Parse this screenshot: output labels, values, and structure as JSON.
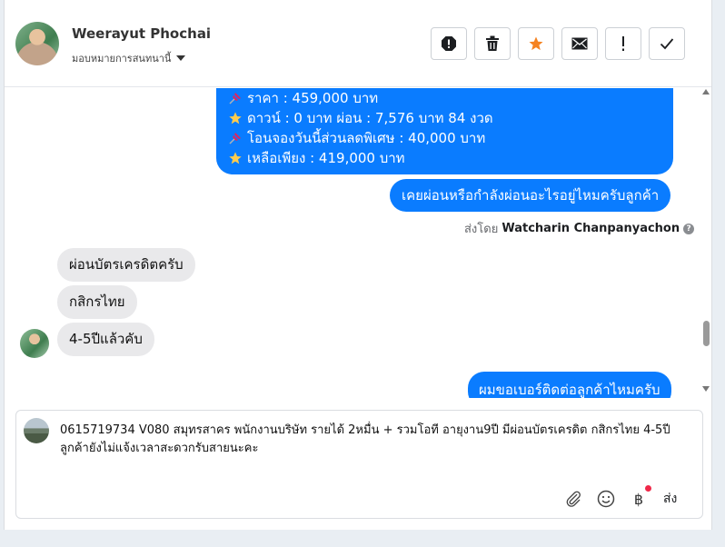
{
  "header": {
    "name": "Weerayut Phochai",
    "assign_label": "มอบหมายการสนทนานี้",
    "actions": [
      "alert-icon",
      "trash-icon",
      "star-icon",
      "mail-icon",
      "exclamation-icon",
      "check-icon"
    ]
  },
  "messages": {
    "offer_lines": [
      {
        "icon": "pin",
        "text": "ราคา : 459,000 บาท"
      },
      {
        "icon": "star",
        "text": "ดาวน์ : 0 บาท ผ่อน : 7,576 บาท 84 งวด"
      },
      {
        "icon": "pin",
        "text": "โอนจองวันนี้ส่วนลดพิเศษ : 40,000 บาท"
      },
      {
        "icon": "star",
        "text": "เหลือเพียง : 419,000 บาท"
      }
    ],
    "question": "เคยผ่อนหรือกำลังผ่อนอะไรอยู่ไหมครับลูกค้า",
    "sent_by_prefix": "ส่งโดย",
    "sent_by_name": "Watcharin Chanpanyachon",
    "incoming": [
      "ผ่อนบัตรเครดิตครับ",
      "กสิกรไทย",
      "4-5ปีแล้วคับ"
    ],
    "last_outgoing": "ผมขอเบอร์ติดต่อลูกค้าไหมครับ"
  },
  "composer": {
    "text": "0615719734 V080 สมุทรสาคร พนักงานบริษัท รายได้ 2หมื่น + รวมโอที อายุงาน9ปี  มีผ่อนบัตรเครดิต กสิกรไทย 4-5ปี ลูกค้ายังไม่แจ้งเวลาสะดวกรับสายนะคะ",
    "baht_symbol": "฿",
    "send_label": "ส่ง"
  },
  "colors": {
    "outgoing_bubble": "#0a7cff",
    "incoming_bubble": "#e9e9eb",
    "star": "#f58220",
    "notification_dot": "#f02849"
  }
}
